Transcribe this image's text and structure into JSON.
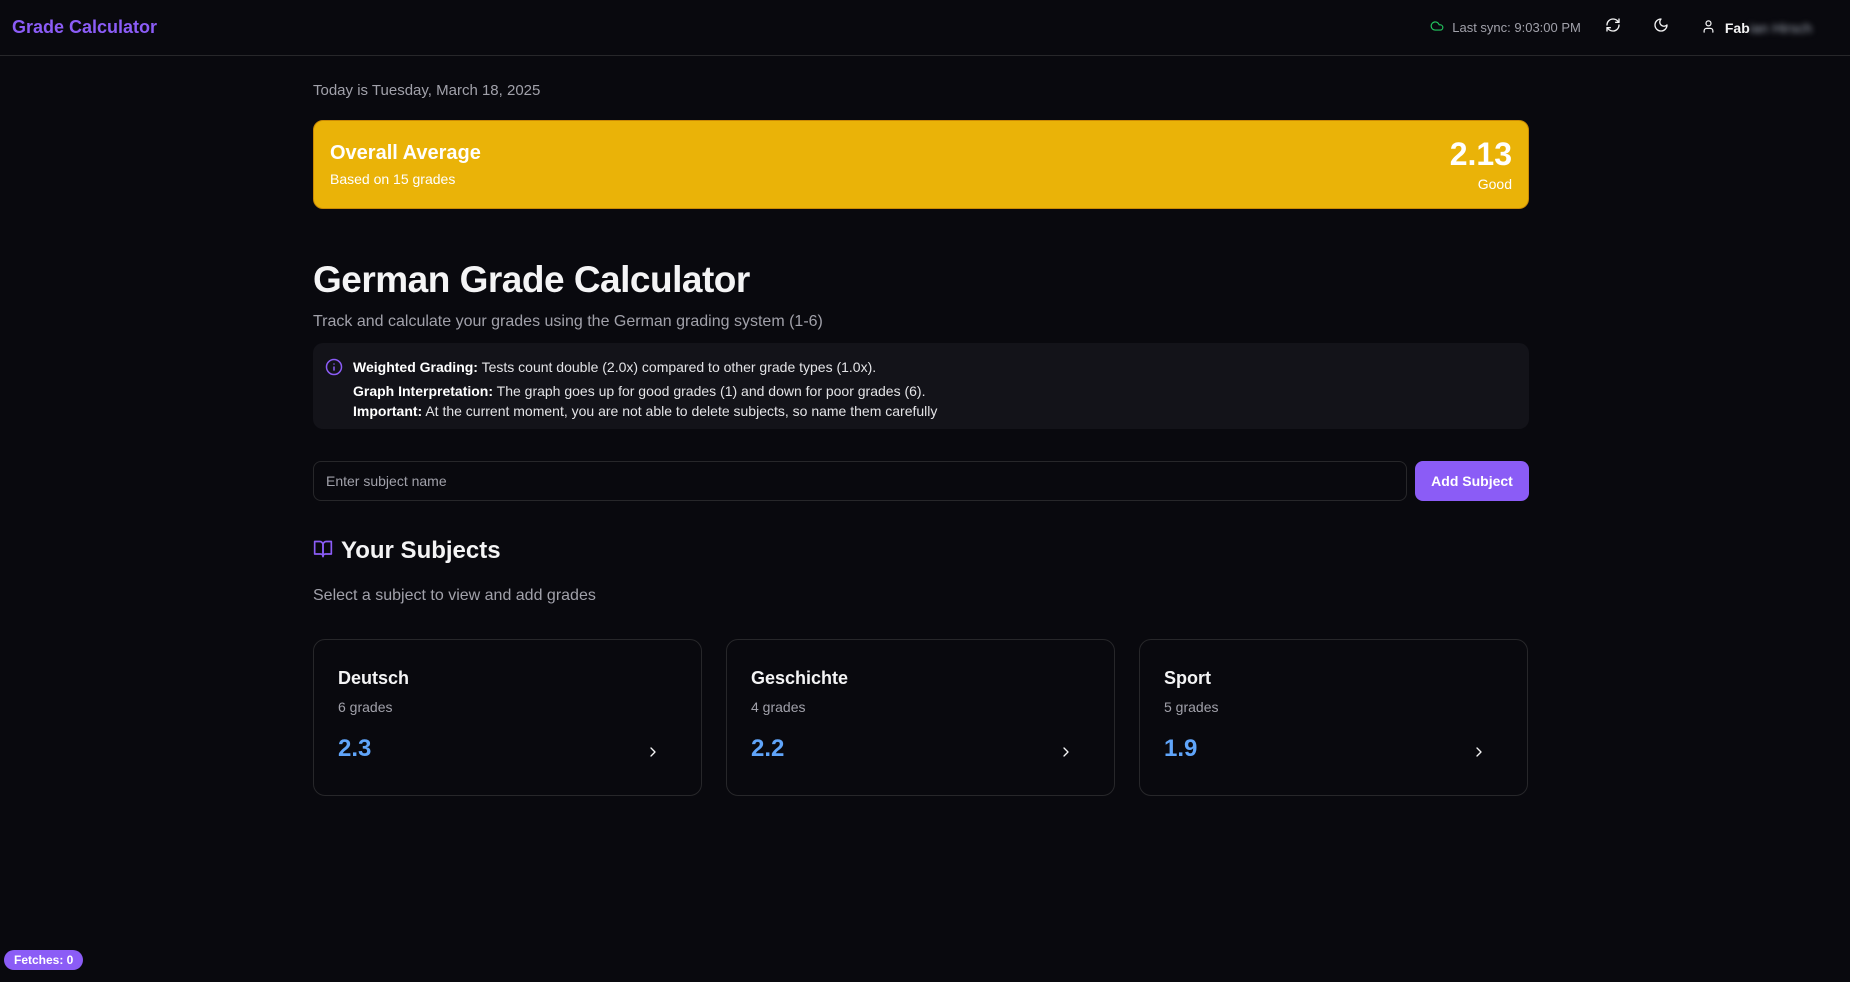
{
  "header": {
    "brand": "Grade Calculator",
    "sync_text": "Last sync: 9:03:00 PM",
    "user_name_visible": "Fab",
    "user_name_blurred": "ian Hirsch",
    "icons": [
      "cloud-icon",
      "refresh-icon",
      "moon-icon",
      "user-icon"
    ]
  },
  "main": {
    "date_text": "Today is Tuesday, March 18, 2025",
    "overall": {
      "title": "Overall Average",
      "subtitle": "Based on 15 grades",
      "value": "2.13",
      "label": "Good",
      "color": "#eab308"
    },
    "title": "German Grade Calculator",
    "subtitle": "Track and calculate your grades using the German grading system (1-6)",
    "info": {
      "line1_label": "Weighted Grading:",
      "line1_text": " Tests count double (2.0x) compared to other grade types (1.0x).",
      "line2_label": "Graph Interpretation:",
      "line2_text": " The graph goes up for good grades (1) and down for poor grades (6).",
      "line3_label": "Important:",
      "line3_text": " At the current moment, you are not able to delete subjects, so name them carefully"
    },
    "add": {
      "placeholder": "Enter subject name",
      "value": "",
      "button": "Add Subject"
    },
    "subjects_title": "Your Subjects",
    "subjects_subtitle": "Select a subject to view and add grades",
    "subjects": [
      {
        "name": "Deutsch",
        "count": "6 grades",
        "average": "2.3"
      },
      {
        "name": "Geschichte",
        "count": "4 grades",
        "average": "2.2"
      },
      {
        "name": "Sport",
        "count": "5 grades",
        "average": "1.9"
      }
    ]
  },
  "footer": {
    "fetches": "Fetches: 0"
  },
  "colors": {
    "accent": "#8b5cf6",
    "background": "#09090e",
    "average_good": "#eab308",
    "subject_average": "#60a5fa",
    "sync_ok": "#22c55e"
  }
}
